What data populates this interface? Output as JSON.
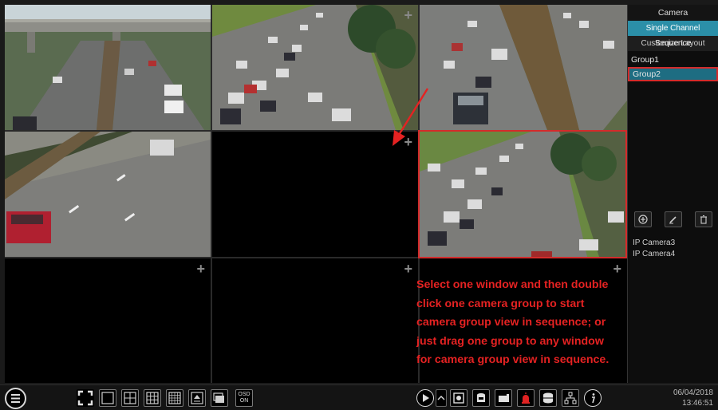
{
  "panel": {
    "title": "Camera",
    "tab_sequence": "Single Channel Sequence",
    "tab_layout": "Customize Layout",
    "groups": [
      "Group1",
      "Group2"
    ],
    "selected_group": "Group2",
    "cameras": [
      "IP Camera3",
      "IP Camera4"
    ],
    "tools": [
      "add-icon",
      "edit-icon",
      "delete-icon"
    ]
  },
  "grid": {
    "empty_cell_marker": "+"
  },
  "instruction": {
    "lines": [
      "Select one window and then double",
      "click one camera group to start",
      "camera group view in sequence; or",
      "just drag one group to any window",
      "for camera group view in sequence."
    ],
    "color": "#e52222"
  },
  "toolbar": {
    "osd_label_top": "OSD",
    "osd_label_bottom": "ON",
    "layout_buttons": [
      "fullscreen-icon",
      "layout-1-icon",
      "layout-4-icon",
      "layout-9-icon",
      "layout-16-icon",
      "layout-custom-icon",
      "scene-icon",
      "osd-toggle"
    ],
    "right_buttons": [
      "play-icon",
      "chevron-up-icon",
      "snapshot-icon",
      "record-icon",
      "playback-icon",
      "alarm-icon",
      "disk-icon",
      "network-icon",
      "info-icon"
    ],
    "date": "06/04/2018",
    "time": "13:46:51"
  },
  "colors": {
    "accent": "#2b8fa8",
    "highlight": "#d42b2b"
  }
}
